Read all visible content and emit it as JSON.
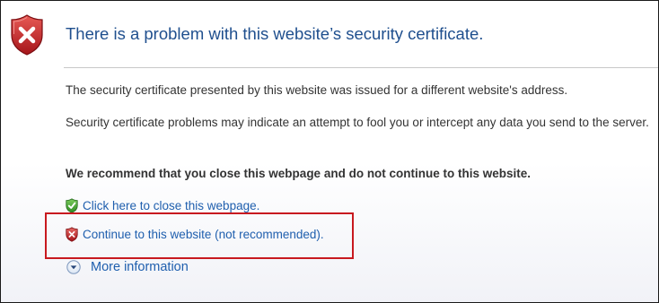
{
  "header": {
    "title": "There is a problem with this website’s security certificate.",
    "icon": "error-shield-icon"
  },
  "body": {
    "paragraph_1": "The security certificate presented by this website was issued for a different website's address.",
    "paragraph_2": "Security certificate problems may indicate an attempt to fool you or intercept any data you send to the server.",
    "recommendation": "We recommend that you close this webpage and do not continue to this website."
  },
  "actions": {
    "close_link": "Click here to close this webpage.",
    "close_icon": "green-check-shield-icon",
    "continue_link": "Continue to this website (not recommended).",
    "continue_icon": "red-x-shield-icon",
    "more_info": "More information",
    "more_info_icon": "chevron-down-circle-icon"
  },
  "colors": {
    "title": "#1f4f8e",
    "link": "#1f5fae",
    "danger": "#c8191f",
    "safe": "#3c9a2e",
    "highlight_border": "#c8191f"
  }
}
